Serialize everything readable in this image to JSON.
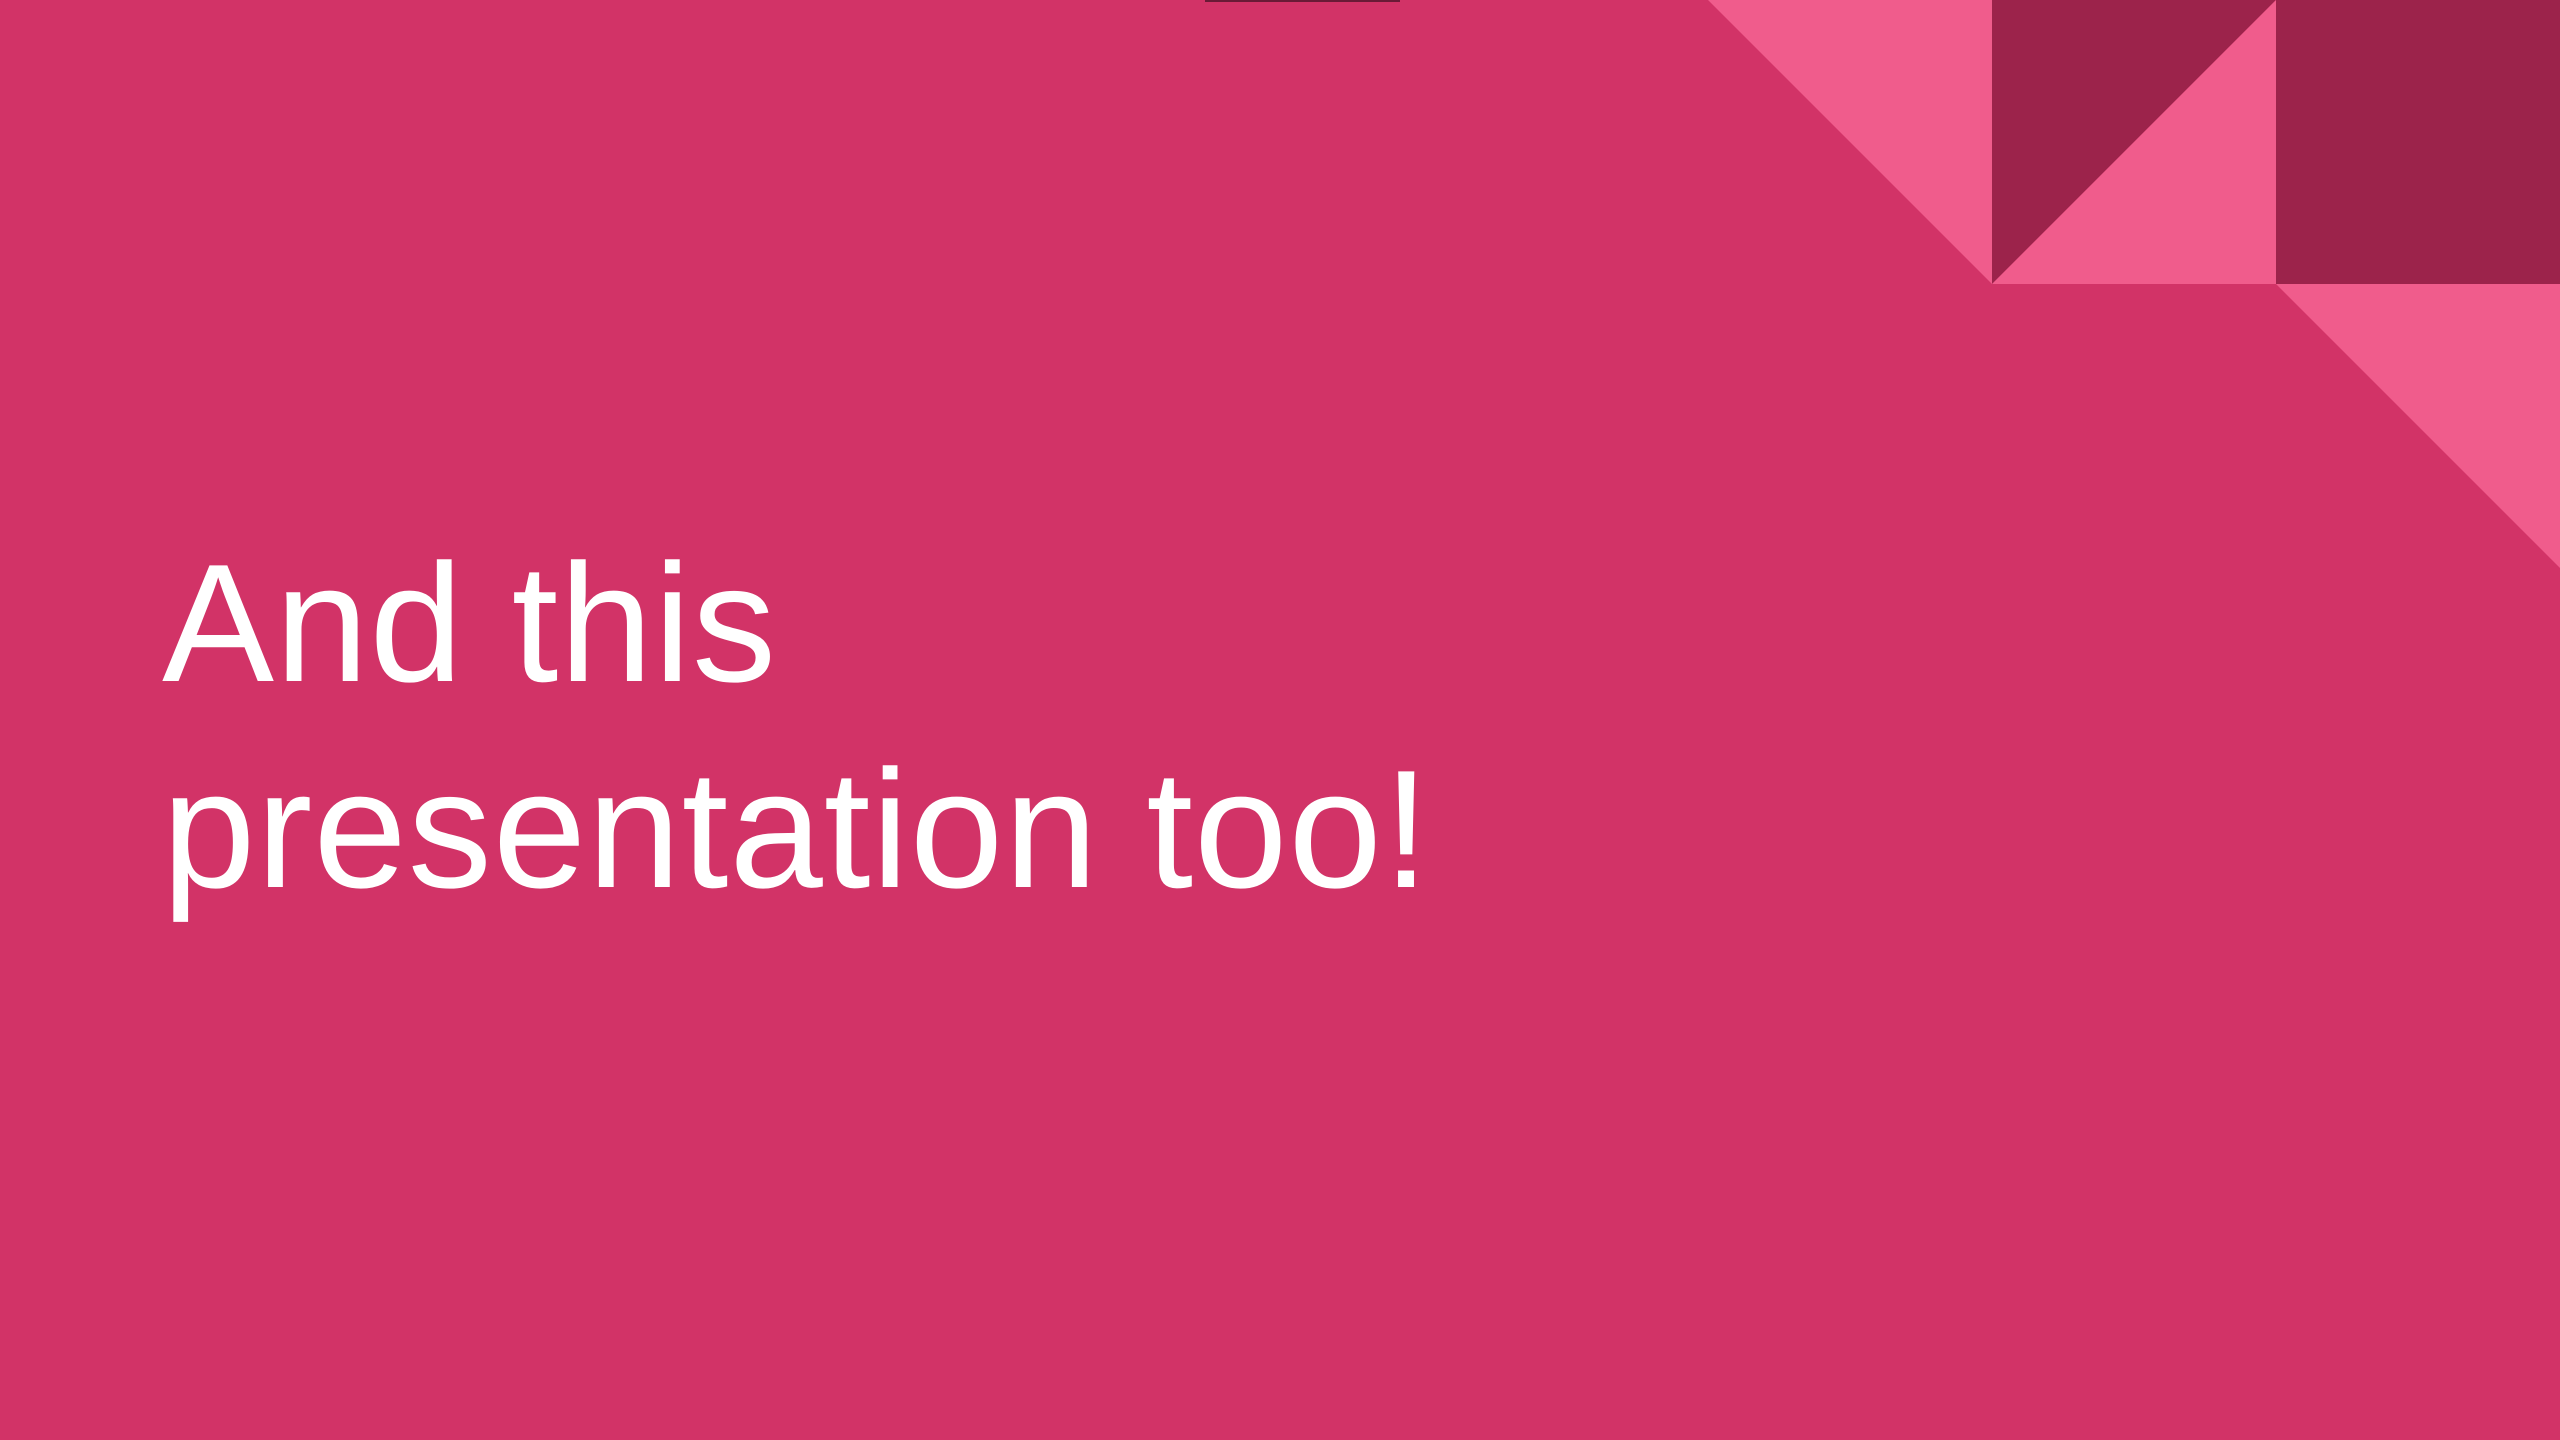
{
  "slide": {
    "title_lines": [
      "And this",
      "presentation too!"
    ]
  },
  "colors": {
    "background": "#d23367",
    "accent_light": "#f05c8c",
    "accent_dark": "#9c234b",
    "text": "#ffffff"
  }
}
